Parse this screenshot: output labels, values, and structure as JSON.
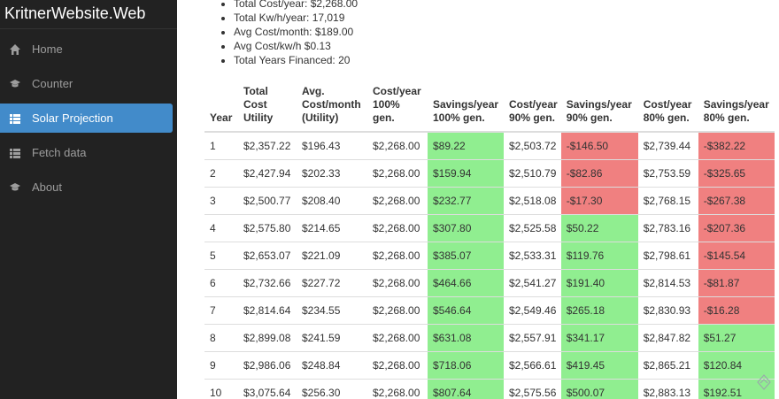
{
  "brand": "KritnerWebsite.Web",
  "nav": [
    {
      "label": "Home",
      "icon": "home-icon",
      "active": false
    },
    {
      "label": "Counter",
      "icon": "education-icon",
      "active": false
    },
    {
      "label": "Solar Projection",
      "icon": "list-icon",
      "active": true
    },
    {
      "label": "Fetch data",
      "icon": "th-list-icon",
      "active": false
    },
    {
      "label": "About",
      "icon": "education-icon",
      "active": false
    }
  ],
  "summary": [
    "Total Cost/year: $2,268.00",
    "Total Kw/h/year: 17,019",
    "Avg Cost/month: $189.00",
    "Avg Cost/kw/h $0.13",
    "Total Years Financed: 20"
  ],
  "table": {
    "headers": [
      [
        "Year"
      ],
      [
        "Total",
        "Cost",
        "Utility"
      ],
      [
        "Avg.",
        "Cost/month",
        "(Utility)"
      ],
      [
        "Cost/year",
        "100%",
        "gen."
      ],
      [
        "Savings/year",
        "100% gen."
      ],
      [
        "Cost/year",
        "90% gen."
      ],
      [
        "Savings/year",
        "90% gen."
      ],
      [
        "Cost/year",
        "80% gen."
      ],
      [
        "Savings/year",
        "80% gen."
      ]
    ],
    "rows": [
      [
        "1",
        "$2,357.22",
        "$196.43",
        "$2,268.00",
        "$89.22",
        "$2,503.72",
        "-$146.50",
        "$2,739.44",
        "-$382.22"
      ],
      [
        "2",
        "$2,427.94",
        "$202.33",
        "$2,268.00",
        "$159.94",
        "$2,510.79",
        "-$82.86",
        "$2,753.59",
        "-$325.65"
      ],
      [
        "3",
        "$2,500.77",
        "$208.40",
        "$2,268.00",
        "$232.77",
        "$2,518.08",
        "-$17.30",
        "$2,768.15",
        "-$267.38"
      ],
      [
        "4",
        "$2,575.80",
        "$214.65",
        "$2,268.00",
        "$307.80",
        "$2,525.58",
        "$50.22",
        "$2,783.16",
        "-$207.36"
      ],
      [
        "5",
        "$2,653.07",
        "$221.09",
        "$2,268.00",
        "$385.07",
        "$2,533.31",
        "$119.76",
        "$2,798.61",
        "-$145.54"
      ],
      [
        "6",
        "$2,732.66",
        "$227.72",
        "$2,268.00",
        "$464.66",
        "$2,541.27",
        "$191.40",
        "$2,814.53",
        "-$81.87"
      ],
      [
        "7",
        "$2,814.64",
        "$234.55",
        "$2,268.00",
        "$546.64",
        "$2,549.46",
        "$265.18",
        "$2,830.93",
        "-$16.28"
      ],
      [
        "8",
        "$2,899.08",
        "$241.59",
        "$2,268.00",
        "$631.08",
        "$2,557.91",
        "$341.17",
        "$2,847.82",
        "$51.27"
      ],
      [
        "9",
        "$2,986.06",
        "$248.84",
        "$2,268.00",
        "$718.06",
        "$2,566.61",
        "$419.45",
        "$2,865.21",
        "$120.84"
      ],
      [
        "10",
        "$3,075.64",
        "$256.30",
        "$2,268.00",
        "$807.64",
        "$2,575.56",
        "$500.07",
        "$2,883.13",
        "$192.51"
      ]
    ]
  },
  "colors": {
    "positive": "#90ee90",
    "negative": "#f08080",
    "active_nav": "#428bca",
    "sidebar": "#222222"
  }
}
